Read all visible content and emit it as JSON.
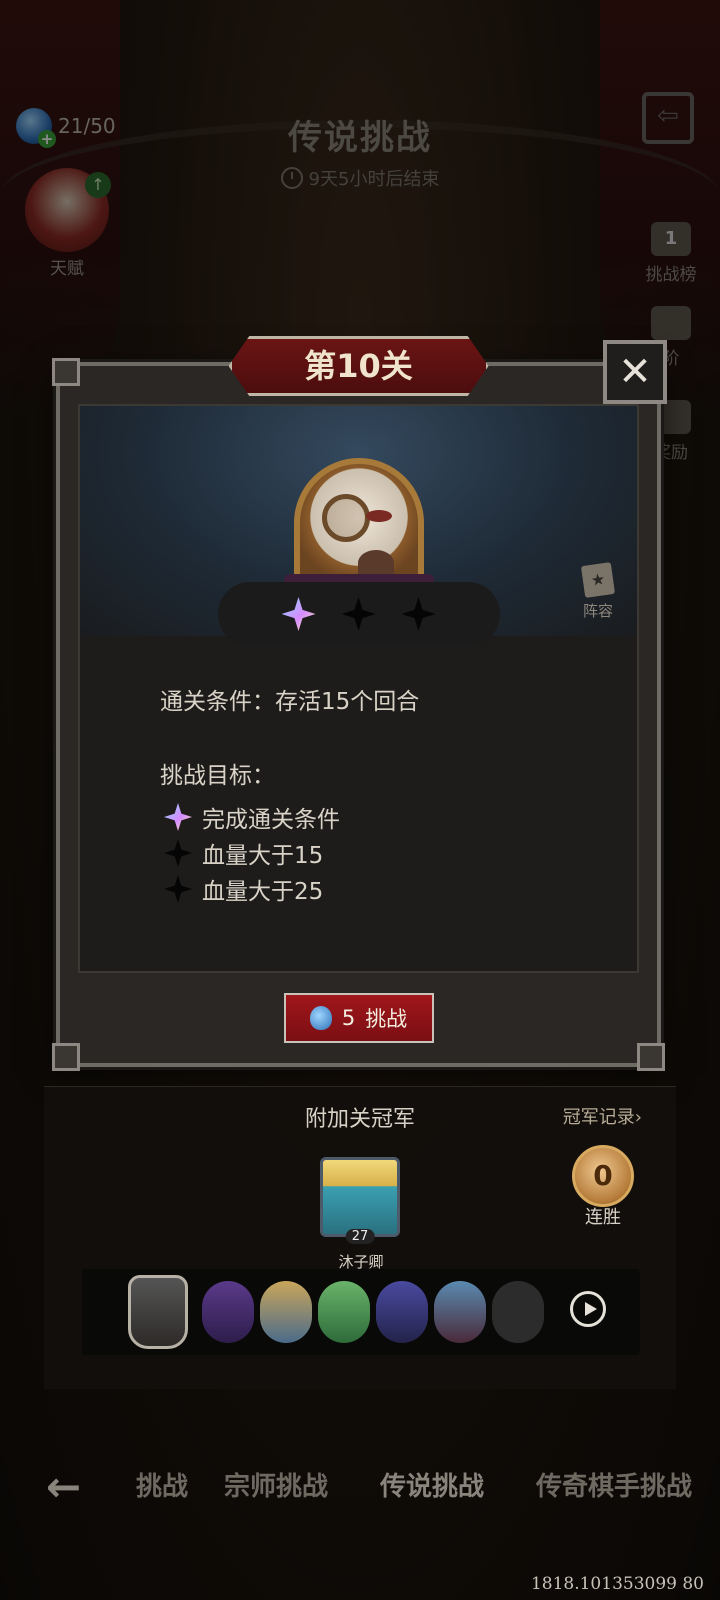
{
  "topbar": {
    "stamina": "21/50",
    "title": "传说挑战",
    "timer": "9天5小时后结束",
    "talent_label": "天赋"
  },
  "side_menu": {
    "leaderboard_icon_text": "1",
    "leaderboard_label": "挑战榜",
    "ladder_label": "阶",
    "reward_label": "奖励"
  },
  "modal": {
    "stage_title": "第10关",
    "close_symbol": "✕",
    "lineup_label": "阵容",
    "stars_earned": 1,
    "stars_total": 3,
    "condition": "通关条件：存活15个回合",
    "goals_title": "挑战目标：",
    "goals": [
      {
        "text": "完成通关条件",
        "achieved": true
      },
      {
        "text": "血量大于15",
        "achieved": false
      },
      {
        "text": "血量大于25",
        "achieved": false
      }
    ],
    "challenge_cost": "5",
    "challenge_label": "挑战"
  },
  "bonus": {
    "title": "附加关冠军",
    "record_link": "冠军记录›",
    "champion_name": "沐子卿",
    "champion_level": "27",
    "streak_value": "0",
    "streak_label": "连胜"
  },
  "bottom_nav": {
    "back": "←",
    "tabs": [
      "挑战",
      "宗师挑战",
      "传说挑战",
      "传奇棋手挑战"
    ],
    "version": "1818.101353099 80"
  },
  "colors": {
    "accent_red": "#8f1317",
    "star_lit": "#c99bff",
    "panel": "#2a2724"
  }
}
